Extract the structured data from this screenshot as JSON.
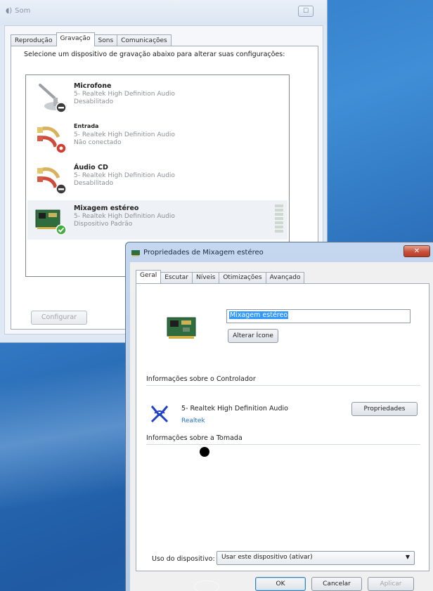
{
  "sound_window": {
    "title": "Som",
    "close_glyph": "☐",
    "tabs": [
      {
        "label": "Reprodução",
        "active": false
      },
      {
        "label": "Gravação",
        "active": true
      },
      {
        "label": "Sons",
        "active": false
      },
      {
        "label": "Comunicações",
        "active": false
      }
    ],
    "instructions": "Selecione um dispositivo de gravação abaixo para alterar suas configurações:",
    "devices": [
      {
        "name": "Microfone",
        "driver": "5- Realtek High Definition Audio",
        "status": "Desabilitado",
        "icon": "microphone-icon",
        "badge": "disabled"
      },
      {
        "name": "Entrada",
        "driver": "5- Realtek High Definition Audio",
        "status": "Não conectado",
        "icon": "rca-cable-icon",
        "badge": "unplugged"
      },
      {
        "name": "Áudio CD",
        "driver": "5- Realtek High Definition Audio",
        "status": "Desabilitado",
        "icon": "rca-cable-icon",
        "badge": "disabled"
      },
      {
        "name": "Mixagem estéreo",
        "driver": "5- Realtek High Definition Audio",
        "status": "Dispositivo Padrão",
        "icon": "sound-card-icon",
        "badge": "default"
      }
    ],
    "configure_label": "Configurar"
  },
  "properties_dialog": {
    "title": "Propriedades de Mixagem estéreo",
    "close_glyph": "✕",
    "tabs": [
      {
        "label": "Geral",
        "active": true
      },
      {
        "label": "Escutar",
        "active": false
      },
      {
        "label": "Níveis",
        "active": false
      },
      {
        "label": "Otimizações",
        "active": false
      },
      {
        "label": "Avançado",
        "active": false
      }
    ],
    "device_name_value": "Mixagem estéreo",
    "change_icon_label": "Alterar Ícone",
    "controller_group_label": "Informações sobre o Controlador",
    "controller_name": "5- Realtek High Definition Audio",
    "controller_vendor": "Realtek",
    "properties_button_label": "Propriedades",
    "jack_group_label": "Informações sobre a Tomada",
    "usage_label": "Uso do dispositivo:",
    "usage_value": "Usar este dispositivo (ativar)",
    "ok_label": "OK",
    "cancel_label": "Cancelar",
    "apply_label": "Aplicar"
  },
  "colors": {
    "selection_blue": "#3399ff",
    "default_badge_green": "#3fae3f",
    "disabled_badge_dark": "#3a3a3a",
    "unplugged_badge_red": "#d63b2f",
    "close_button_red": "#c9503b",
    "link_blue": "#1f6fd1"
  }
}
